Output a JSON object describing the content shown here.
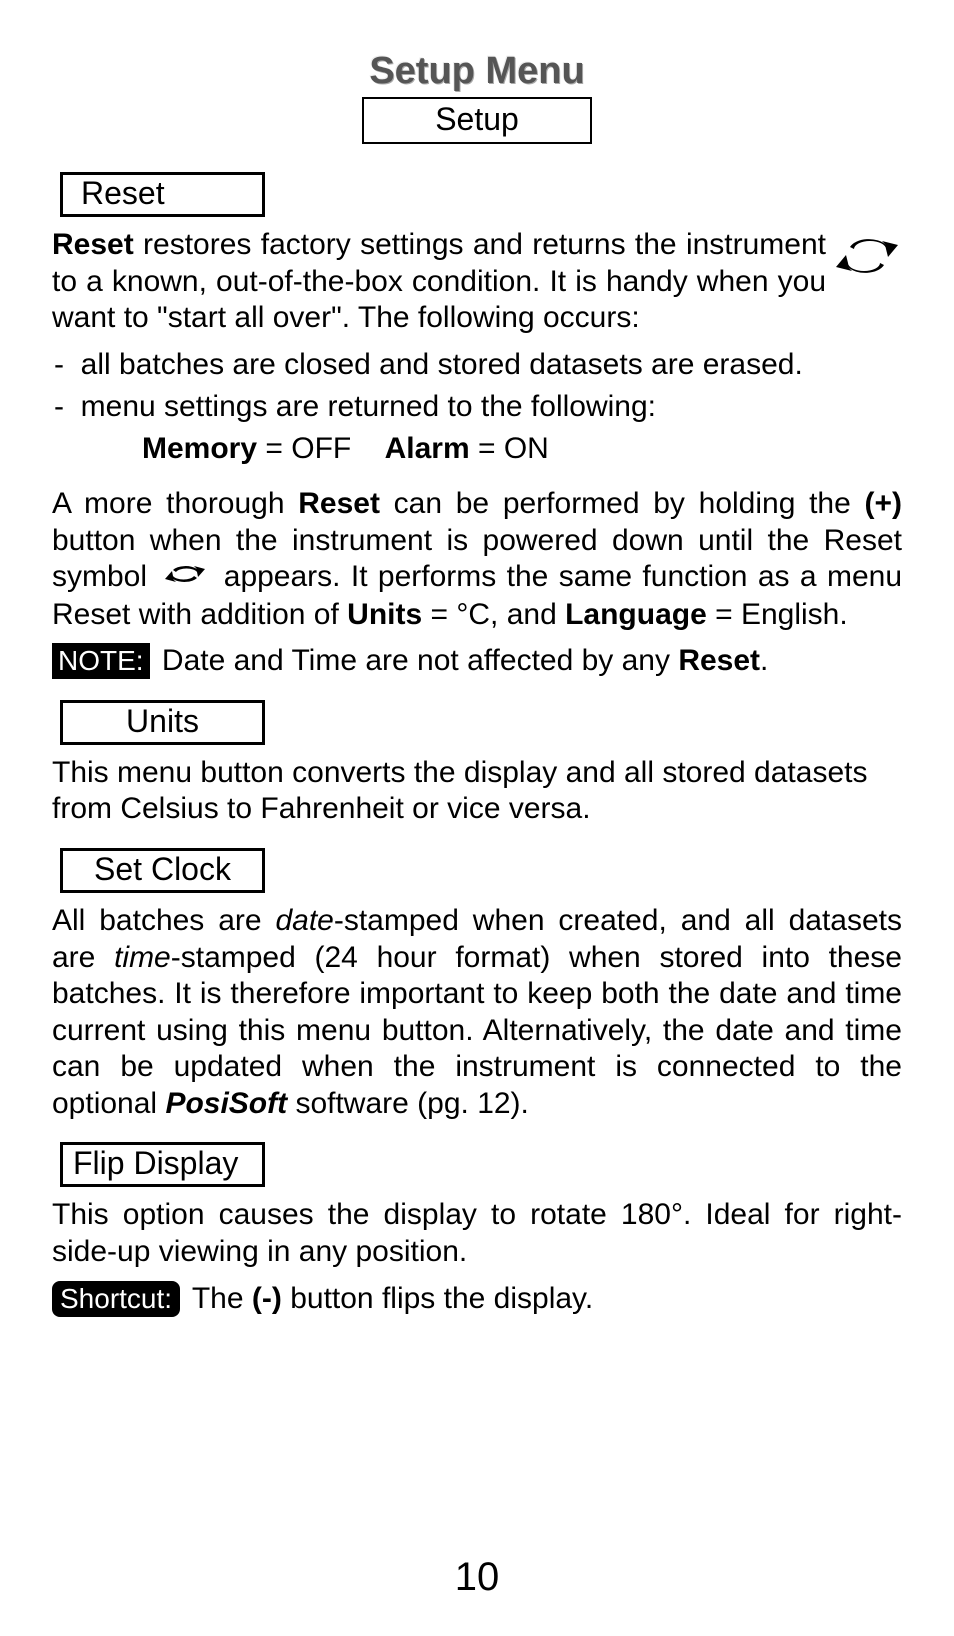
{
  "title": "Setup Menu",
  "setup_label": "Setup",
  "reset": {
    "label": "Reset",
    "p1_a": "Reset",
    "p1_b": " restores factory settings and returns the instrument to a known, out-of-the-box condition. It is handy when you want to \"start all over\". The following occurs:",
    "bullet1": "all batches are closed and stored datasets are erased.",
    "bullet2": "menu settings are returned to the following:",
    "mem_label": "Memory",
    "mem_val": " = OFF",
    "alarm_label": "Alarm",
    "alarm_val": " = ON",
    "p2_a": "A more thorough ",
    "p2_b": "Reset",
    "p2_c": " can be performed by holding the ",
    "p2_d": "(+)",
    "p2_e": " button when the instrument is powered down until the Reset symbol ",
    "p2_f": " appears. It performs the same function as a menu Reset with addition of ",
    "p2_g": "Units",
    "p2_h": " = °C, and ",
    "p2_i": "Language",
    "p2_j": " = English.",
    "note_badge": "NOTE:",
    "note_text_a": " Date and Time are not affected by any ",
    "note_text_b": "Reset",
    "note_text_c": "."
  },
  "units": {
    "label": "Units",
    "p1": "This menu button converts the display and all stored datasets from Celsius to Fahrenheit or vice versa."
  },
  "clock": {
    "label": "Set Clock",
    "p1_a": "All batches are ",
    "p1_b": "date",
    "p1_c": "-stamped when created, and all datasets are ",
    "p1_d": "time",
    "p1_e": "-stamped (24 hour format) when stored into these batches. It is therefore important to keep both the date and time current using this menu button. Alternatively, the date and time can be updated when the instrument is connected to the optional ",
    "p1_f": "PosiSoft",
    "p1_g": " software (pg. 12)."
  },
  "flip": {
    "label": "Flip Display",
    "p1": "This option causes the display to rotate 180°. Ideal for right-side-up viewing in any position.",
    "shortcut_badge": "Shortcut:",
    "shortcut_a": " The ",
    "shortcut_b": "(-)",
    "shortcut_c": " button flips the display."
  },
  "page_number": "10"
}
